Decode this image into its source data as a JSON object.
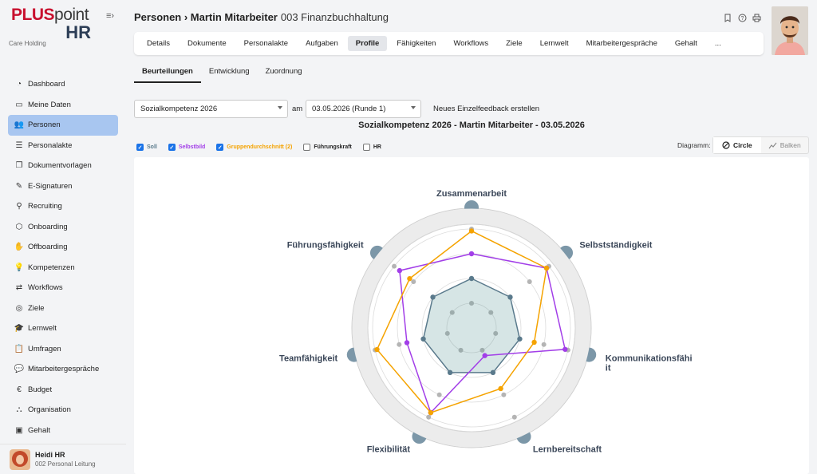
{
  "brand": {
    "line1_a": "PLUS",
    "line1_b": "point",
    "line2": "HR"
  },
  "org": "Care Holding",
  "nav": [
    {
      "label": "Dashboard",
      "icon": "gauge-icon",
      "glyph": "◔"
    },
    {
      "label": "Meine Daten",
      "icon": "folder-icon",
      "glyph": "▭"
    },
    {
      "label": "Personen",
      "icon": "people-icon",
      "glyph": "👥",
      "active": true
    },
    {
      "label": "Personalakte",
      "icon": "file-list-icon",
      "glyph": "☰"
    },
    {
      "label": "Dokumentvorlagen",
      "icon": "documents-icon",
      "glyph": "❐"
    },
    {
      "label": "E-Signaturen",
      "icon": "pen-icon",
      "glyph": "✎"
    },
    {
      "label": "Recruiting",
      "icon": "search-people-icon",
      "glyph": "⚲"
    },
    {
      "label": "Onboarding",
      "icon": "handshake-icon",
      "glyph": "⬡"
    },
    {
      "label": "Offboarding",
      "icon": "hand-icon",
      "glyph": "✋"
    },
    {
      "label": "Kompetenzen",
      "icon": "bulb-icon",
      "glyph": "💡"
    },
    {
      "label": "Workflows",
      "icon": "workflow-icon",
      "glyph": "⇄"
    },
    {
      "label": "Ziele",
      "icon": "target-icon",
      "glyph": "◎"
    },
    {
      "label": "Lernwelt",
      "icon": "graduation-icon",
      "glyph": "🎓"
    },
    {
      "label": "Umfragen",
      "icon": "clipboard-icon",
      "glyph": "📋"
    },
    {
      "label": "Mitarbeitergespräche",
      "icon": "chat-icon",
      "glyph": "💬"
    },
    {
      "label": "Budget",
      "icon": "euro-icon",
      "glyph": "€"
    },
    {
      "label": "Organisation",
      "icon": "org-chart-icon",
      "glyph": "⛬"
    },
    {
      "label": "Gehalt",
      "icon": "money-icon",
      "glyph": "▣"
    }
  ],
  "user": {
    "name": "Heidi HR",
    "role": "002 Personal Leitung"
  },
  "header": {
    "title": "Personen › Martin Mitarbeiter",
    "subtitle": "003 Finanzbuchhaltung"
  },
  "tabs": [
    "Details",
    "Dokumente",
    "Personalakte",
    "Aufgaben",
    "Profile",
    "Fähigkeiten",
    "Workflows",
    "Ziele",
    "Lernwelt",
    "Mitarbeitergespräche",
    "Gehalt",
    "..."
  ],
  "active_tab": "Profile",
  "subtabs": [
    "Beurteilungen",
    "Entwicklung",
    "Zuordnung"
  ],
  "controls": {
    "assessment": "Sozialkompetenz 2026",
    "am": "am",
    "date": "03.05.2026 (Runde 1)",
    "new_feedback": "Neues Einzelfeedback erstellen"
  },
  "chart_title": "Sozialkompetenz 2026 - Martin Mitarbeiter - 03.05.2026",
  "legend": [
    {
      "label": "Soll",
      "checked": true,
      "color": "#5a7a8c"
    },
    {
      "label": "Selbstbild",
      "checked": true,
      "color": "#a23ee8"
    },
    {
      "label": "Gruppendurchschnitt (2)",
      "checked": true,
      "color": "#f5a300"
    },
    {
      "label": "Führungskraft",
      "checked": false,
      "color": "#222222"
    },
    {
      "label": "HR",
      "checked": false,
      "color": "#222222"
    }
  ],
  "diagram": {
    "label": "Diagramm:",
    "circle": "Circle",
    "bars": "Balken"
  },
  "chart_data": {
    "type": "radar",
    "axes": [
      "Zusammenarbeit",
      "Selbstständigkeit",
      "Kommunikationsfähigkeit",
      "Lernbereitschaft",
      "Flexibilität",
      "Teamfähigkeit",
      "Führungsfähigkeit"
    ],
    "axis_label_lines": [
      [
        "Zusammenarbeit"
      ],
      [
        "Selbstständigkeit"
      ],
      [
        "Kommunikationsfähi",
        "it"
      ],
      [
        "Lernbereitschaft"
      ],
      [
        "Flexibilität"
      ],
      [
        "Teamfähigkeit"
      ],
      [
        "Führungsfähigkeit"
      ]
    ],
    "series": [
      {
        "name": "Soll",
        "color": "#5a7a8c",
        "values": [
          0.5,
          0.5,
          0.5,
          0.5,
          0.5,
          0.5,
          0.5
        ]
      },
      {
        "name": "Selbstbild",
        "color": "#a23ee8",
        "values": [
          0.75,
          0.97,
          0.97,
          0.31,
          0.95,
          0.67,
          0.93
        ]
      },
      {
        "name": "Gruppendurchschnitt (2)",
        "color": "#f5a300",
        "values": [
          0.98,
          0.97,
          0.65,
          0.68,
          0.95,
          0.98,
          0.8
        ]
      }
    ],
    "range": [
      0,
      1
    ]
  }
}
